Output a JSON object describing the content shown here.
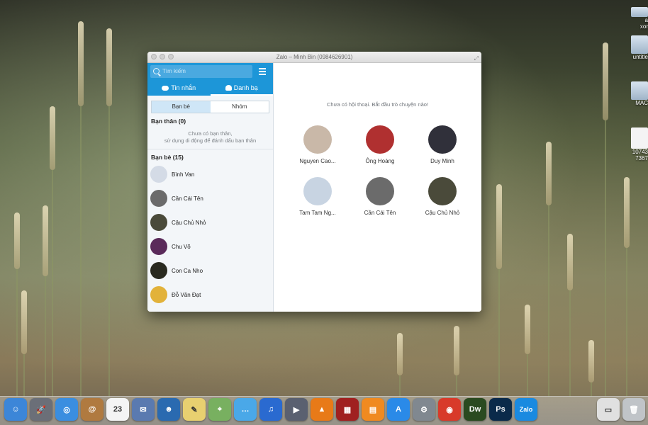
{
  "window": {
    "title": "Zalo – Minh Bin (0984626901)"
  },
  "sidebar": {
    "search_placeholder": "Tìm kiếm",
    "tabs": [
      {
        "label": "Tin nhắn",
        "icon": "chat-icon"
      },
      {
        "label": "Danh bạ",
        "icon": "contacts-icon"
      }
    ],
    "segments": [
      "Bạn bè",
      "Nhóm"
    ],
    "close_friends": {
      "title": "Bạn thân (0)",
      "empty_line1": "Chưa có bạn thân,",
      "empty_line2": "sử dụng di động để đánh dấu bạn thân"
    },
    "friends": {
      "title": "Bạn bè (15)",
      "items": [
        {
          "name": "Bình Van",
          "avatar_color": "#d4dbe6"
        },
        {
          "name": "Cần Cái Tên",
          "avatar_color": "#6b6b6b"
        },
        {
          "name": "Cậu Chủ Nhỏ",
          "avatar_color": "#4a4a3a"
        },
        {
          "name": "Chu Võ",
          "avatar_color": "#5a2a5a"
        },
        {
          "name": "Con Ca Nho",
          "avatar_color": "#2a2a20"
        },
        {
          "name": "Đỗ Văn Đạt",
          "avatar_color": "#e2b23a"
        }
      ]
    }
  },
  "main": {
    "hint": "Chưa có hội thoại. Bắt đầu trò chuyện nào!",
    "contacts": [
      {
        "name": "Nguyen Cao...",
        "avatar_color": "#c9b8a8"
      },
      {
        "name": "Ông Hoàng",
        "avatar_color": "#b03030"
      },
      {
        "name": "Duy Minh",
        "avatar_color": "#30303a"
      },
      {
        "name": "Tam Tam Ng...",
        "avatar_color": "#c8d4e2"
      },
      {
        "name": "Cần Cái Tên",
        "avatar_color": "#6b6b6b"
      },
      {
        "name": "Cậu Chủ Nhỏ",
        "avatar_color": "#4a4a3a"
      }
    ]
  },
  "desktop": {
    "icons": [
      "a\nxor",
      "untitle",
      "MAC",
      "10743\n7367"
    ]
  },
  "dock": {
    "items": [
      {
        "name": "finder-icon",
        "color": "#3c86d8",
        "glyph": "☺"
      },
      {
        "name": "launchpad-icon",
        "color": "#6b6f78",
        "glyph": "🚀"
      },
      {
        "name": "safari-icon",
        "color": "#3a8ee0",
        "glyph": "◎"
      },
      {
        "name": "contacts-app-icon",
        "color": "#b07a40",
        "glyph": "@"
      },
      {
        "name": "calendar-icon",
        "color": "#f4f4f4",
        "glyph": "23"
      },
      {
        "name": "mail-icon",
        "color": "#5a7ab0",
        "glyph": "✉"
      },
      {
        "name": "preview-icon",
        "color": "#2a6ab0",
        "glyph": "☻"
      },
      {
        "name": "notes-icon",
        "color": "#e8d070",
        "glyph": "✎"
      },
      {
        "name": "maps-icon",
        "color": "#78b060",
        "glyph": "⌖"
      },
      {
        "name": "messages-icon",
        "color": "#4aa8e8",
        "glyph": "…"
      },
      {
        "name": "itunes-icon",
        "color": "#2a6ad0",
        "glyph": "♫"
      },
      {
        "name": "facetime-icon",
        "color": "#5a6070",
        "glyph": "▶"
      },
      {
        "name": "vlc-icon",
        "color": "#e87a18",
        "glyph": "▲"
      },
      {
        "name": "photo-booth-icon",
        "color": "#a02020",
        "glyph": "▦"
      },
      {
        "name": "ibooks-icon",
        "color": "#f08a20",
        "glyph": "▤"
      },
      {
        "name": "app-store-icon",
        "color": "#2a8ae8",
        "glyph": "A"
      },
      {
        "name": "system-preferences-icon",
        "color": "#808890",
        "glyph": "⚙"
      },
      {
        "name": "chrome-icon",
        "color": "#d83a2a",
        "glyph": "◉"
      },
      {
        "name": "dreamweaver-icon",
        "color": "#2a4a20",
        "glyph": "Dw"
      },
      {
        "name": "photoshop-icon",
        "color": "#0a2a4a",
        "glyph": "Ps"
      },
      {
        "name": "zalo-icon",
        "color": "#1a8ae0",
        "glyph": "Zalo"
      }
    ],
    "right_items": [
      {
        "name": "downloads-stack-icon",
        "color": "#e0e0e0",
        "glyph": "▭"
      },
      {
        "name": "trash-icon",
        "color": "#c0c4c8",
        "glyph": "🗑"
      }
    ]
  }
}
